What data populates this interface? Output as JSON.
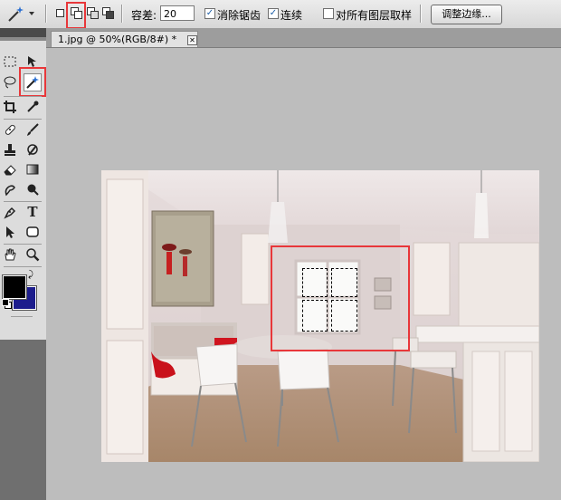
{
  "options_bar": {
    "tolerance_label": "容差:",
    "tolerance_value": "20",
    "anti_alias_label": "消除锯齿",
    "anti_alias_checked": true,
    "contiguous_label": "连续",
    "contiguous_checked": true,
    "sample_all_layers_label": "对所有图层取样",
    "sample_all_layers_checked": false,
    "refine_edge_label": "调整边缘..."
  },
  "document_tab": {
    "title": "1.jpg @ 50%(RGB/8#) *",
    "close_glyph": "✕"
  },
  "toolbox": {
    "type_tool_glyph": "T"
  },
  "colors": {
    "foreground": "#000000",
    "background": "#1c1c8c",
    "highlight": "#e8373a"
  }
}
